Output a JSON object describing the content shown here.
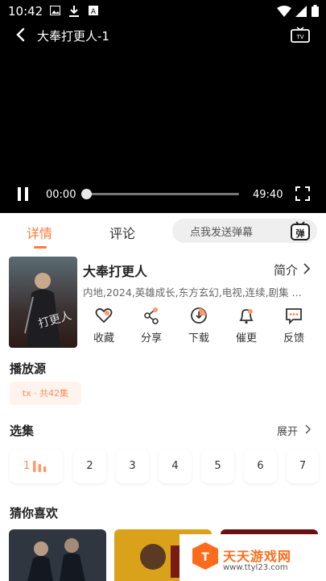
{
  "status_bar": {
    "time": "10:42"
  },
  "player": {
    "title": "大奉打更人-1",
    "current_time": "00:00",
    "duration": "49:40",
    "progress": 0
  },
  "tabs": [
    {
      "label": "详情",
      "active": true
    },
    {
      "label": "评论",
      "active": false
    }
  ],
  "danmaku": {
    "placeholder": "点我发送弹幕",
    "icon_text": "弹"
  },
  "show": {
    "title": "大奉打更人",
    "intro_label": "简介",
    "tags": "内地,2024,英雄成长,东方玄幻,电视,连续,剧集 ...",
    "poster_text": "打更人"
  },
  "actions": [
    {
      "label": "收藏",
      "icon": "heart-icon"
    },
    {
      "label": "分享",
      "icon": "share-icon"
    },
    {
      "label": "下载",
      "icon": "download-icon"
    },
    {
      "label": "催更",
      "icon": "bell-icon"
    },
    {
      "label": "反馈",
      "icon": "feedback-icon"
    }
  ],
  "source_section": {
    "title": "播放源",
    "source": "tx · 共42集"
  },
  "episodes_section": {
    "title": "选集",
    "expand_label": "展开",
    "episodes": [
      "1",
      "2",
      "3",
      "4",
      "5",
      "6",
      "7"
    ],
    "active_index": 0
  },
  "recommend_section": {
    "title": "猜你喜欢"
  },
  "watermark": {
    "name": "天天游戏网",
    "url": "www.ttyl23.com"
  },
  "colors": {
    "accent": "#ff7a3a",
    "accent_soft": "#fff3ee"
  }
}
